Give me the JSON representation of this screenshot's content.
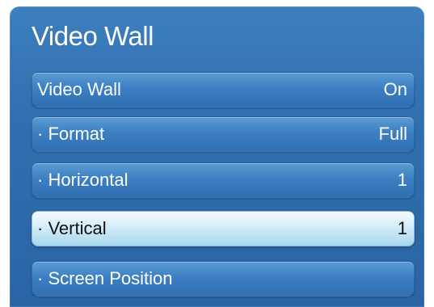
{
  "panel": {
    "title": "Video Wall"
  },
  "items": [
    {
      "label": "Video Wall",
      "value": "On"
    },
    {
      "label": "· Format",
      "value": "Full"
    },
    {
      "label": "· Horizontal",
      "value": "1"
    },
    {
      "label": "· Vertical",
      "value": "1"
    },
    {
      "label": "· Screen Position",
      "value": ""
    }
  ],
  "colors": {
    "panel_blue": "#3170b0",
    "selected_highlight": "#a7d8ec"
  }
}
